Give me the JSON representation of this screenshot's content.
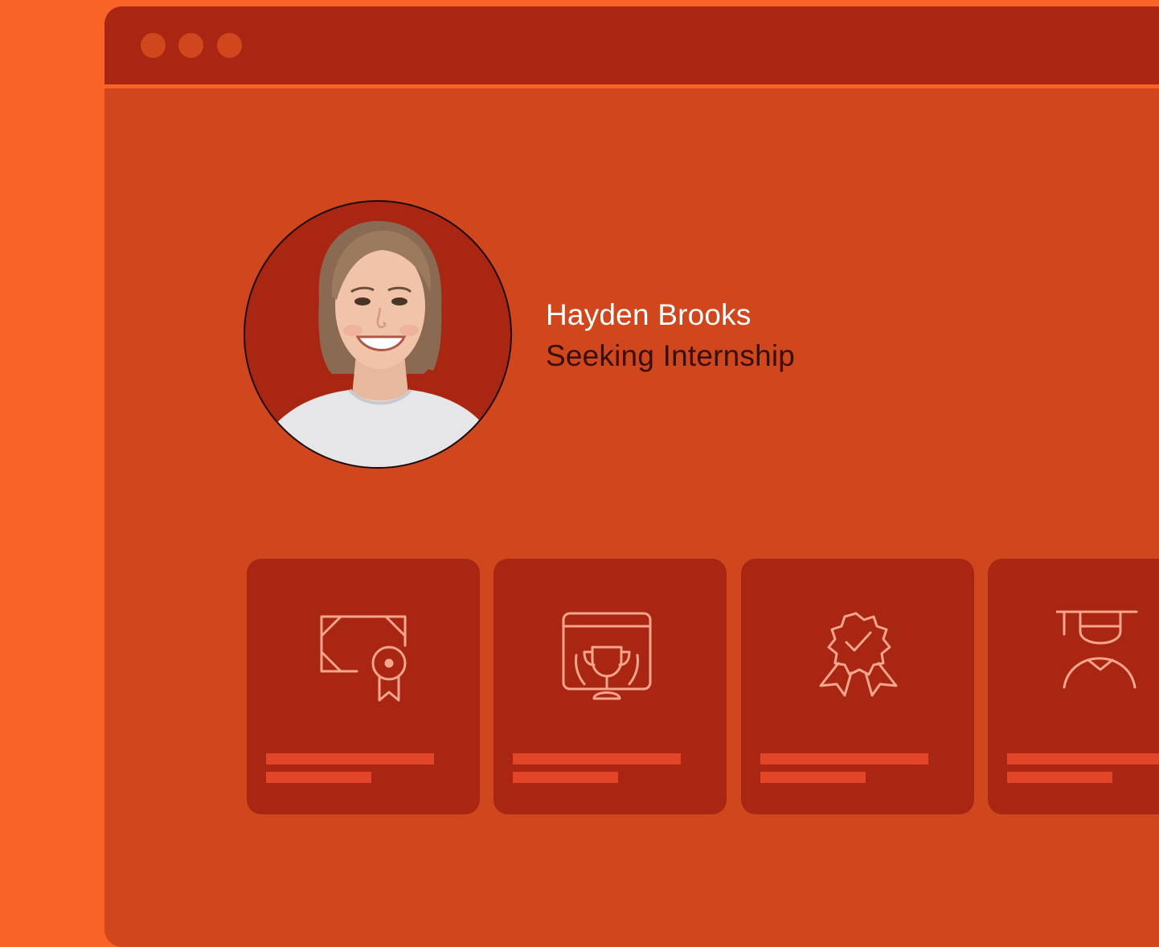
{
  "window": {
    "titlebar_controls": [
      "close-dot",
      "minimize-dot",
      "maximize-dot"
    ]
  },
  "profile": {
    "name": "Hayden Brooks",
    "status": "Seeking Internship"
  },
  "cards": [
    {
      "icon": "certificate-icon"
    },
    {
      "icon": "trophy-screen-icon"
    },
    {
      "icon": "award-badge-icon"
    },
    {
      "icon": "graduate-icon"
    }
  ],
  "colors": {
    "page_background": "#F96328",
    "window_background": "#D0461D",
    "titlebar": "#A92712",
    "card_background": "#A92712",
    "icon_stroke": "#F8A58E",
    "placeholder_bar": "#E24527",
    "name_text": "#FFFFFF",
    "status_text": "#3A0E0A"
  }
}
